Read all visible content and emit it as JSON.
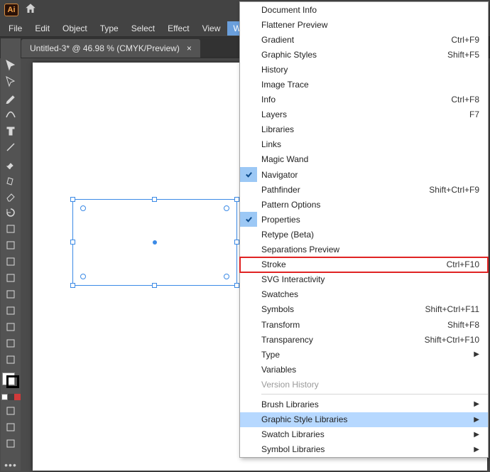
{
  "app": {
    "badge": "Ai"
  },
  "menubar": [
    "File",
    "Edit",
    "Object",
    "Type",
    "Select",
    "Effect",
    "View",
    "Window"
  ],
  "active_menu_index": 7,
  "document_tab": {
    "title": "Untitled-3* @ 46.98 % (CMYK/Preview)",
    "close": "×"
  },
  "window_menu": {
    "items": [
      {
        "label": "Document Info"
      },
      {
        "label": "Flattener Preview"
      },
      {
        "label": "Gradient",
        "shortcut": "Ctrl+F9"
      },
      {
        "label": "Graphic Styles",
        "shortcut": "Shift+F5"
      },
      {
        "label": "History"
      },
      {
        "label": "Image Trace"
      },
      {
        "label": "Info",
        "shortcut": "Ctrl+F8"
      },
      {
        "label": "Layers",
        "shortcut": "F7"
      },
      {
        "label": "Libraries"
      },
      {
        "label": "Links"
      },
      {
        "label": "Magic Wand"
      },
      {
        "label": "Navigator",
        "checked": true
      },
      {
        "label": "Pathfinder",
        "shortcut": "Shift+Ctrl+F9"
      },
      {
        "label": "Pattern Options"
      },
      {
        "label": "Properties",
        "checked": true
      },
      {
        "label": "Retype (Beta)"
      },
      {
        "label": "Separations Preview"
      },
      {
        "label": "Stroke",
        "shortcut": "Ctrl+F10",
        "highlight_box": true
      },
      {
        "label": "SVG Interactivity"
      },
      {
        "label": "Swatches"
      },
      {
        "label": "Symbols",
        "shortcut": "Shift+Ctrl+F11"
      },
      {
        "label": "Transform",
        "shortcut": "Shift+F8"
      },
      {
        "label": "Transparency",
        "shortcut": "Shift+Ctrl+F10"
      },
      {
        "label": "Type",
        "submenu": true
      },
      {
        "label": "Variables"
      },
      {
        "label": "Version History",
        "disabled": true
      },
      {
        "separator": true
      },
      {
        "label": "Brush Libraries",
        "submenu": true
      },
      {
        "label": "Graphic Style Libraries",
        "submenu": true,
        "hovered": true
      },
      {
        "label": "Swatch Libraries",
        "submenu": true
      },
      {
        "label": "Symbol Libraries",
        "submenu": true
      }
    ]
  },
  "tools": [
    "selection",
    "direct-selection",
    "pen",
    "curvature",
    "type",
    "line",
    "rectangle",
    "paintbrush",
    "shaper",
    "eraser",
    "rotate",
    "scale",
    "width",
    "free-transform",
    "shape-builder",
    "perspective",
    "mesh",
    "gradient",
    "eyedropper",
    "blend",
    "symbol-sprayer",
    "column-graph",
    "artboard",
    "slice",
    "hand",
    "zoom"
  ]
}
